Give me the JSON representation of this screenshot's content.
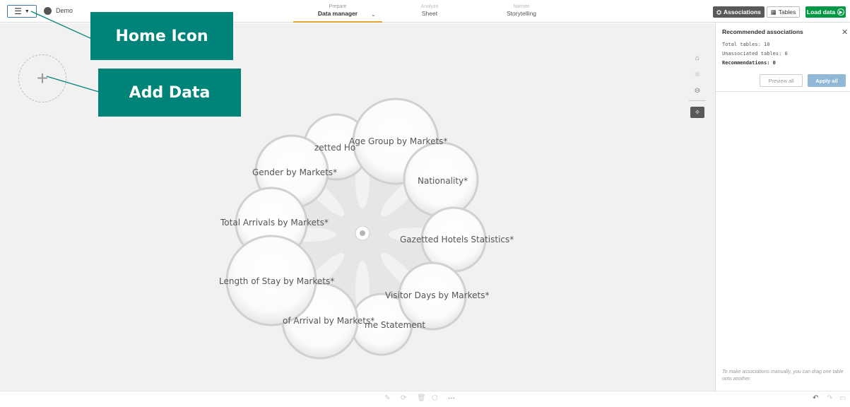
{
  "header": {
    "app_name": "Demo",
    "menu_icon": "hamburger-icon",
    "tabs": [
      {
        "small": "Prepare",
        "label": "Data manager",
        "active": true
      },
      {
        "small": "Analyze",
        "label": "Sheet",
        "active": false
      },
      {
        "small": "Narrate",
        "label": "Storytelling",
        "active": false
      }
    ],
    "associations_label": "Associations",
    "tables_label": "Tables",
    "load_data_label": "Load data"
  },
  "callouts": {
    "home": "Home Icon",
    "add": "Add Data"
  },
  "canvas": {
    "add_symbol": "+",
    "bubbles": [
      {
        "label": "Age Group by Markets*"
      },
      {
        "label": "zetted Ho"
      },
      {
        "label": "Gender by Markets*"
      },
      {
        "label": "Nationality*"
      },
      {
        "label": "Total Arrivals by Markets*"
      },
      {
        "label": "Gazetted Hotels Statistics*"
      },
      {
        "label": "Length of Stay by Markets*"
      },
      {
        "label": "Visitor Days by Markets*"
      },
      {
        "label": "of Arrival by Markets*"
      },
      {
        "label": "me Statement"
      }
    ]
  },
  "panel": {
    "title": "Recommended associations",
    "total_tables": "Total tables: 10",
    "unassociated": "Unassociated tables: 0",
    "recommendations": "Recommendations: 0",
    "preview_all": "Preview all",
    "apply_all": "Apply all",
    "hint": "To make associations manually, you can drag one table onto another."
  },
  "colors": {
    "accent_green": "#009845",
    "callout_teal": "#00847a",
    "tab_underline": "#e6a22e",
    "apply_blue": "#8fb8d6"
  }
}
